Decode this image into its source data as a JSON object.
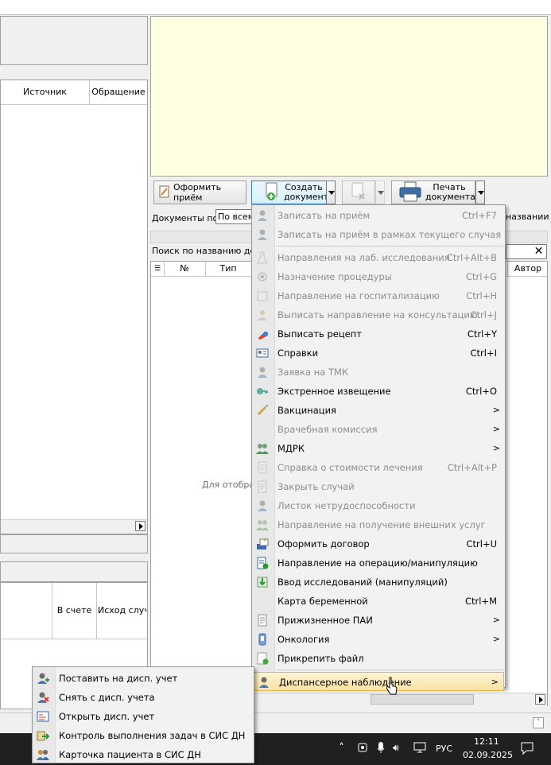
{
  "left_panel": {
    "columns": [
      "Источник",
      "Обращение"
    ],
    "lower_columns": [
      "В счете",
      "Исход случа"
    ]
  },
  "toolbar": {
    "accept_label": "Оформить приём",
    "create_doc_label": "Создать документ",
    "print_doc_label": "Печать документа"
  },
  "filter": {
    "docs_by_label": "Документы по:",
    "docs_by_value": "По всем",
    "by_name_label": "названии ",
    "search_label": "Поиск по названию доку",
    "empty_text": "Для отобра"
  },
  "docs_table": {
    "columns": [
      "№",
      "Тип",
      "Автор"
    ]
  },
  "context_menu": {
    "items": [
      {
        "label": "Записать на приём",
        "shortcut": "Ctrl+F7",
        "disabled": true,
        "icon": "person-icon"
      },
      {
        "label": "Записать на приём в рамках текущего случая",
        "shortcut": "",
        "disabled": true,
        "icon": "person-icon"
      },
      {
        "label": "Направления на лаб. исследования",
        "shortcut": "Ctrl+Alt+B",
        "disabled": true,
        "icon": "flask-icon"
      },
      {
        "label": "Назначение процедуры",
        "shortcut": "Ctrl+G",
        "disabled": true,
        "icon": "procedure-icon"
      },
      {
        "label": "Направление на госпитализацию",
        "shortcut": "Ctrl+H",
        "disabled": true,
        "icon": "hospital-icon"
      },
      {
        "label": "Выписать направление на консультацию",
        "shortcut": "Ctrl+J",
        "disabled": true,
        "icon": "consult-icon"
      },
      {
        "label": "Выписать рецепт",
        "shortcut": "Ctrl+Y",
        "disabled": false,
        "icon": "pill-icon"
      },
      {
        "label": "Справки",
        "shortcut": "Ctrl+I",
        "disabled": false,
        "icon": "id-card-icon"
      },
      {
        "label": "Заявка на ТМК",
        "shortcut": "",
        "disabled": true,
        "icon": "person-icon"
      },
      {
        "label": "Экстренное извещение",
        "shortcut": "Ctrl+O",
        "disabled": false,
        "icon": "key-icon"
      },
      {
        "label": "Вакцинация",
        "shortcut": ">",
        "disabled": false,
        "icon": "syringe-icon"
      },
      {
        "label": "Врачебная комиссия",
        "shortcut": ">",
        "disabled": true,
        "icon": ""
      },
      {
        "label": "МДРК",
        "shortcut": ">",
        "disabled": false,
        "icon": "group-icon"
      },
      {
        "label": "Справка о стоимости лечения",
        "shortcut": "Ctrl+Alt+P",
        "disabled": true,
        "icon": "doc-icon"
      },
      {
        "label": "Закрыть случай",
        "shortcut": "",
        "disabled": true,
        "icon": "doc-icon"
      },
      {
        "label": "Листок нетрудоспособности",
        "shortcut": "",
        "disabled": true,
        "icon": "person-icon"
      },
      {
        "label": "Направление на получение внешних услуг",
        "shortcut": "",
        "disabled": true,
        "icon": "group-icon"
      },
      {
        "label": "Оформить договор",
        "shortcut": "Ctrl+U",
        "disabled": false,
        "icon": "contract-icon"
      },
      {
        "label": "Направление на операцию/манипуляцию",
        "shortcut": "",
        "disabled": false,
        "icon": "operation-icon"
      },
      {
        "label": "Ввод исследований (манипуляций)",
        "shortcut": "",
        "disabled": false,
        "icon": "download-icon"
      },
      {
        "label": "Карта беременной",
        "shortcut": "Ctrl+M",
        "disabled": false,
        "icon": ""
      },
      {
        "label": "Прижизненное ПАИ",
        "shortcut": ">",
        "disabled": false,
        "icon": "doc-icon"
      },
      {
        "label": "Онкология",
        "shortcut": ">",
        "disabled": false,
        "icon": "oncology-icon"
      },
      {
        "label": "Прикрепить файл",
        "shortcut": "",
        "disabled": false,
        "icon": "attach-icon"
      },
      {
        "label": "Диспансерное наблюдение",
        "shortcut": ">",
        "disabled": false,
        "icon": "person-icon",
        "highlighted": true
      }
    ]
  },
  "submenu": {
    "items": [
      {
        "label": "Поставить на дисп. учет",
        "icon": "person-add-icon"
      },
      {
        "label": "Снять с дисп. учета",
        "icon": "person-remove-icon"
      },
      {
        "label": "Открыть дисп. учет",
        "icon": "open-record-icon"
      },
      {
        "label": "Контроль выполнения задач в СИС ДН",
        "icon": "forward-icon"
      },
      {
        "label": "Карточка пациента в СИС ДН",
        "icon": "people-icon"
      }
    ]
  },
  "taskbar": {
    "language": "РУС",
    "time": "12:11",
    "date": "02.09.2025"
  }
}
